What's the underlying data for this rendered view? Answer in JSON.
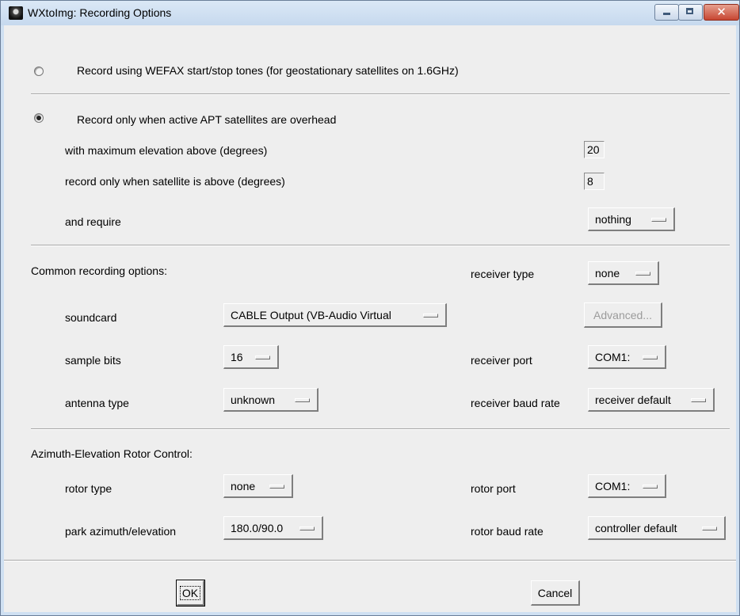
{
  "window": {
    "title": "WXtoImg: Recording Options",
    "close_glyph": "✕"
  },
  "mode": {
    "wefax_label": "Record using WEFAX start/stop tones (for geostationary satellites on 1.6GHz)",
    "wefax_selected": false,
    "apt_label": "Record only when active APT satellites are overhead",
    "apt_selected": true
  },
  "apt": {
    "max_elevation_label": "with maximum elevation above (degrees)",
    "max_elevation_value": "20",
    "min_elevation_label": "record only when satellite is above (degrees)",
    "min_elevation_value": "8",
    "require_label": "and require",
    "require_value": "nothing"
  },
  "common": {
    "heading": "Common recording options:",
    "receiver_type_label": "receiver type",
    "receiver_type_value": "none",
    "soundcard_label": "soundcard",
    "soundcard_value": "CABLE Output (VB-Audio Virtual",
    "advanced_label": "Advanced...",
    "sample_bits_label": "sample bits",
    "sample_bits_value": "16",
    "receiver_port_label": "receiver port",
    "receiver_port_value": "COM1:",
    "antenna_type_label": "antenna type",
    "antenna_type_value": "unknown",
    "receiver_baud_label": "receiver baud rate",
    "receiver_baud_value": "receiver default"
  },
  "rotor": {
    "heading": "Azimuth-Elevation Rotor Control:",
    "rotor_type_label": "rotor type",
    "rotor_type_value": "none",
    "rotor_port_label": "rotor port",
    "rotor_port_value": "COM1:",
    "park_label": "park azimuth/elevation",
    "park_value": "180.0/90.0",
    "rotor_baud_label": "rotor baud rate",
    "rotor_baud_value": "controller default"
  },
  "buttons": {
    "ok": "OK",
    "cancel": "Cancel"
  }
}
